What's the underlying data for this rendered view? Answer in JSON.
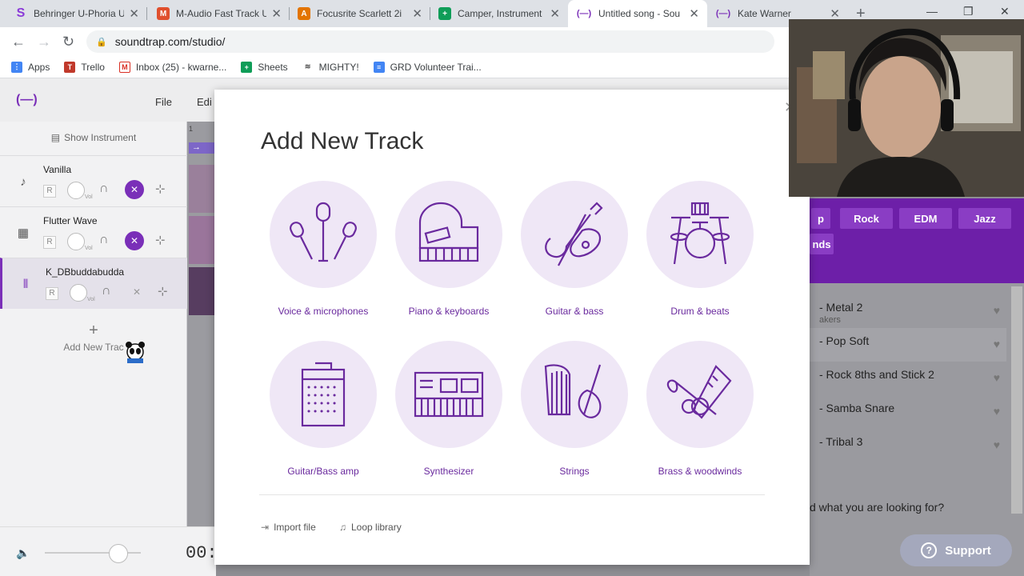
{
  "browser": {
    "tabs": [
      {
        "title": "Behringer U-Phoria U",
        "favicon": "S",
        "color": "#8a3ad8"
      },
      {
        "title": "M-Audio Fast Track U",
        "favicon": "M",
        "color": "#e04f2d"
      },
      {
        "title": "Focusrite Scarlett 2i",
        "favicon": "A",
        "color": "#e37400"
      },
      {
        "title": "Camper, Instrument",
        "favicon": "+",
        "color": "#0f9d58"
      },
      {
        "title": "Untitled song - Sou",
        "favicon": "(—)",
        "color": "#7a2fb8"
      },
      {
        "title": "Kate Warner",
        "favicon": "(—)",
        "color": "#7a2fb8"
      }
    ],
    "url": "soundtrap.com/studio/",
    "bookmarks": [
      {
        "label": "Apps",
        "icon": "apps-grid-icon",
        "color": "#4285f4"
      },
      {
        "label": "Trello",
        "icon": "trello-icon",
        "color": "#c0392b"
      },
      {
        "label": "Inbox (25) - kwarne...",
        "icon": "gmail-icon",
        "color": "#d93025"
      },
      {
        "label": "Sheets",
        "icon": "sheets-icon",
        "color": "#0f9d58"
      },
      {
        "label": "MIGHTY!",
        "icon": "mighty-icon",
        "color": "#555"
      },
      {
        "label": "GRD Volunteer Trai...",
        "icon": "docs-icon",
        "color": "#4285f4"
      }
    ]
  },
  "app": {
    "logo": "(—)",
    "menu": [
      "File",
      "Edi"
    ],
    "show_instrument": "Show Instrument",
    "tracks": [
      {
        "name": "Vanilla",
        "icon": "♪",
        "rec": "R",
        "vol": "Vol",
        "muted": true
      },
      {
        "name": "Flutter Wave",
        "icon": "▦",
        "rec": "R",
        "vol": "Vol",
        "muted": true
      },
      {
        "name": "K_DBbuddabudda",
        "icon": "|||",
        "rec": "R",
        "vol": "Vol",
        "muted": false
      }
    ],
    "add_track": "Add New Trac",
    "ruler_mark": "1",
    "time": "00:",
    "genres": [
      "p",
      "Rock",
      "EDM",
      "Jazz",
      "nds"
    ],
    "loops": [
      {
        "name": "- Metal 2",
        "sub": "akers"
      },
      {
        "name": "- Pop Soft",
        "sub": ""
      },
      {
        "name": "- Rock 8ths and Stick 2",
        "sub": ""
      },
      {
        "name": "- Samba Snare",
        "sub": ""
      },
      {
        "name": "- Tribal 3",
        "sub": ""
      }
    ],
    "looking_for": "d what you are looking for?",
    "support": "Support",
    "accent": "#7a2fb8"
  },
  "modal": {
    "title": "Add New Track",
    "instruments": [
      {
        "label": "Voice & microphones",
        "icon": "microphones-icon"
      },
      {
        "label": "Piano & keyboards",
        "icon": "piano-icon"
      },
      {
        "label": "Guitar & bass",
        "icon": "guitar-icon"
      },
      {
        "label": "Drum & beats",
        "icon": "drums-icon"
      },
      {
        "label": "Guitar/Bass amp",
        "icon": "amp-icon"
      },
      {
        "label": "Synthesizer",
        "icon": "synthesizer-icon"
      },
      {
        "label": "Strings",
        "icon": "strings-icon"
      },
      {
        "label": "Brass & woodwinds",
        "icon": "brass-icon"
      }
    ],
    "import_file": "Import file",
    "loop_library": "Loop library"
  }
}
